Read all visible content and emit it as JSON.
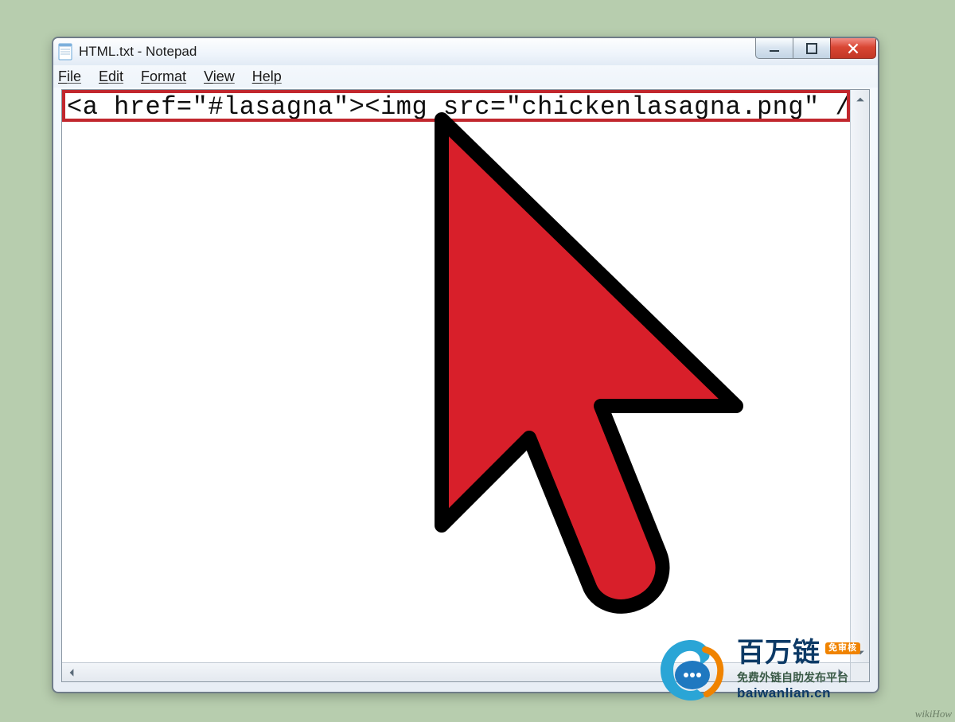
{
  "window": {
    "title": "HTML.txt - Notepad",
    "menus": {
      "file": {
        "letter": "F",
        "rest": "ile"
      },
      "edit": {
        "letter": "E",
        "rest": "dit"
      },
      "format": {
        "letter": "F",
        "rest": "ormat"
      },
      "view": {
        "letter": "V",
        "rest": "iew"
      },
      "help": {
        "letter": "H",
        "rest": "elp"
      }
    }
  },
  "editor": {
    "line1": "<a href=\"#lasagna\"><img src=\"chickenlasagna.png\" /></a>"
  },
  "watermark": {
    "brand": "百万链",
    "badge": "免审核",
    "subtitle": "免费外链自助发布平台",
    "domain": "baiwanlian.cn"
  },
  "footer": {
    "credit": "wikiHow"
  }
}
